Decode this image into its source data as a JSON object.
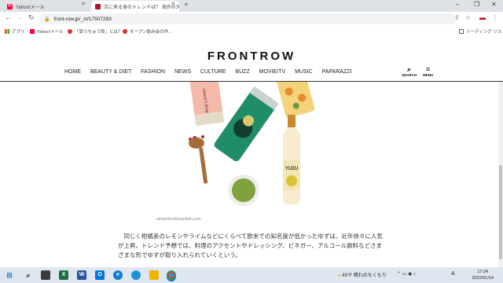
{
  "browser": {
    "tabs": [
      {
        "title": "Yahoo!メール",
        "active": false
      },
      {
        "title": "次に来る食のトレンドは？ 海外の大…",
        "active": true
      }
    ],
    "url": "front-row.jp/_ct/17507293",
    "bookmarks": [
      "アプリ",
      "Yahoo!メール",
      "「郭うちゅう郎」とは？",
      "オープン飲み会の作…"
    ],
    "reading_list": "リーディング リスト"
  },
  "site": {
    "logo": "FRONTROW",
    "menu": [
      "HOME",
      "BEAUTY & DIET",
      "FASHION",
      "NEWS",
      "CULTURE",
      "BUZZ",
      "MOVIE/TV",
      "MUSIC",
      "PAPARAZZI"
    ],
    "search_label": "SEARCH",
    "menu_label": "MENU"
  },
  "article": {
    "image_caption": "wholefoodsmarket.com",
    "image_labels": {
      "can_left": "Acai Lemon",
      "bottle": "YUZU"
    },
    "paragraph": "　同じく柑橘系のレモンやライムなどにくらべて欧米での知名度が低かったゆずは、近年徐々に人気が上昇。トレンド予想では、料理のアクセントやドレッシング、ビネガー、アルコール飲料などさまざまな形でゆずが取り入れられていくという。"
  },
  "taskbar": {
    "weather_temp": "40°F",
    "weather_text": "晴れのちくもり",
    "ime": "A",
    "time": "17:24",
    "date": "2022/01/14"
  }
}
